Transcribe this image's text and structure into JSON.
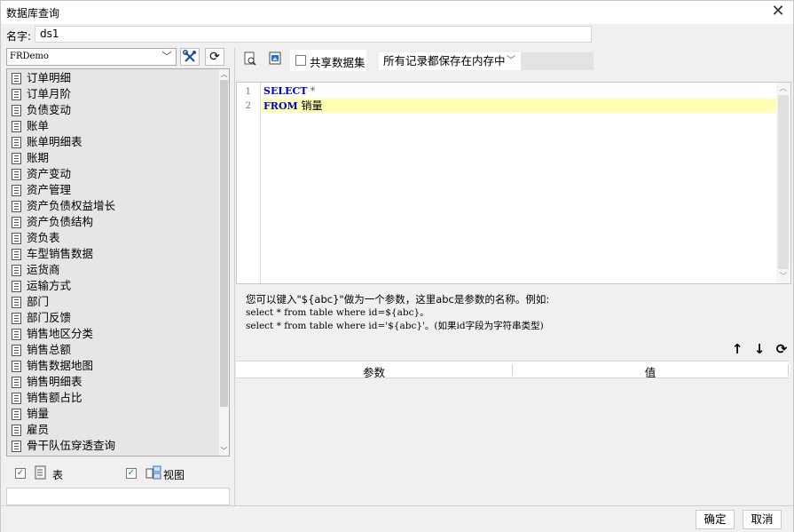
{
  "dialog": {
    "title": "数据库查询",
    "close_icon": "close-icon"
  },
  "name_field": {
    "label": "名字:",
    "value": "ds1"
  },
  "connection": {
    "selected": "FRDemo"
  },
  "tables": [
    "订单明细",
    "订单月阶",
    "负债变动",
    "账单",
    "账单明细表",
    "账期",
    "资产变动",
    "资产管理",
    "资产负债权益增长",
    "资产负债结构",
    "资负表",
    "车型销售数据",
    "运货商",
    "运输方式",
    "部门",
    "部门反馈",
    "销售地区分类",
    "销售总额",
    "销售数据地图",
    "销售明细表",
    "销售额占比",
    "销量",
    "雇员",
    "骨干队伍穿透查询"
  ],
  "filters": {
    "tables_label": "表",
    "views_label": "视图",
    "tables_checked": true,
    "views_checked": true
  },
  "toolbar": {
    "share_label": "共享数据集",
    "memory_option": "所有记录都保存在内存中"
  },
  "editor": {
    "lines": [
      {
        "num": "1",
        "keyword": "SELECT",
        "rest": " *"
      },
      {
        "num": "2",
        "keyword": "FROM",
        "rest": " 销量"
      }
    ]
  },
  "hint": {
    "line1": "您可以键入\"${abc}\"做为一个参数，这里abc是参数的名称。例如:",
    "line2": "select * from table where id=${abc}。",
    "line3": "select * from table where id='${abc}'。(如果id字段为字符串类型)"
  },
  "params_table": {
    "col_param": "参数",
    "col_value": "值"
  },
  "footer": {
    "ok_label": "确定",
    "cancel_label": "取消"
  }
}
